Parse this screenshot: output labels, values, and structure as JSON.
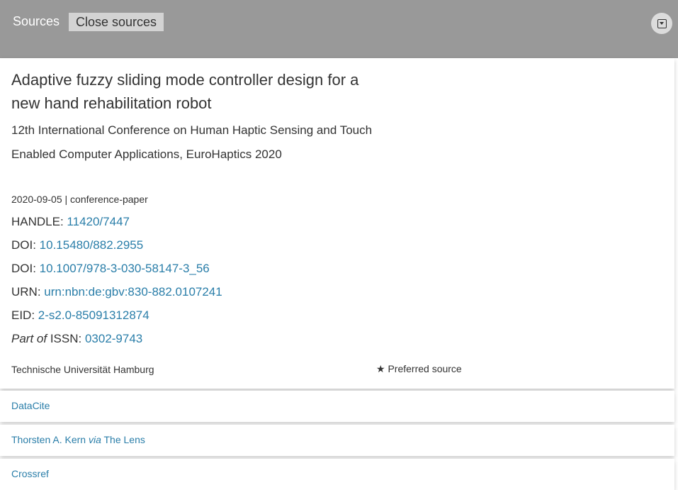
{
  "header": {
    "title": "Sources",
    "close_label": "Close sources",
    "toggle_icon": "collapse-icon"
  },
  "record": {
    "title": "Adaptive fuzzy sliding mode controller design for a new hand rehabilitation robot",
    "conference": "12th International Conference on Human Haptic Sensing and Touch Enabled Computer Applications, EuroHaptics 2020",
    "date": "2020-09-05",
    "separator": "|",
    "type": "conference-paper",
    "identifiers": [
      {
        "label": "HANDLE: ",
        "value": "11420/7447"
      },
      {
        "label": "DOI: ",
        "value": "10.15480/882.2955"
      },
      {
        "label": "DOI: ",
        "value": "10.1007/978-3-030-58147-3_56"
      },
      {
        "label": "URN: ",
        "value": "urn:nbn:de:gbv:830-882.0107241"
      },
      {
        "label": "EID: ",
        "value": "2-s2.0-85091312874"
      }
    ],
    "issn": {
      "part_of": "Part of",
      "label": " ISSN: ",
      "value": "0302-9743"
    },
    "organization": "Technische Universität Hamburg",
    "preferred_icon": "star-icon",
    "preferred_star": "★",
    "preferred_label": "Preferred source"
  },
  "sources": [
    {
      "label": "DataCite"
    },
    {
      "author": "Thorsten A. Kern",
      "via": "via",
      "label": "The Lens"
    },
    {
      "label": "Crossref"
    }
  ],
  "colors": {
    "header_bg": "#999999",
    "link": "#2a7ea9",
    "close_button_bg": "#d3d3d3"
  }
}
